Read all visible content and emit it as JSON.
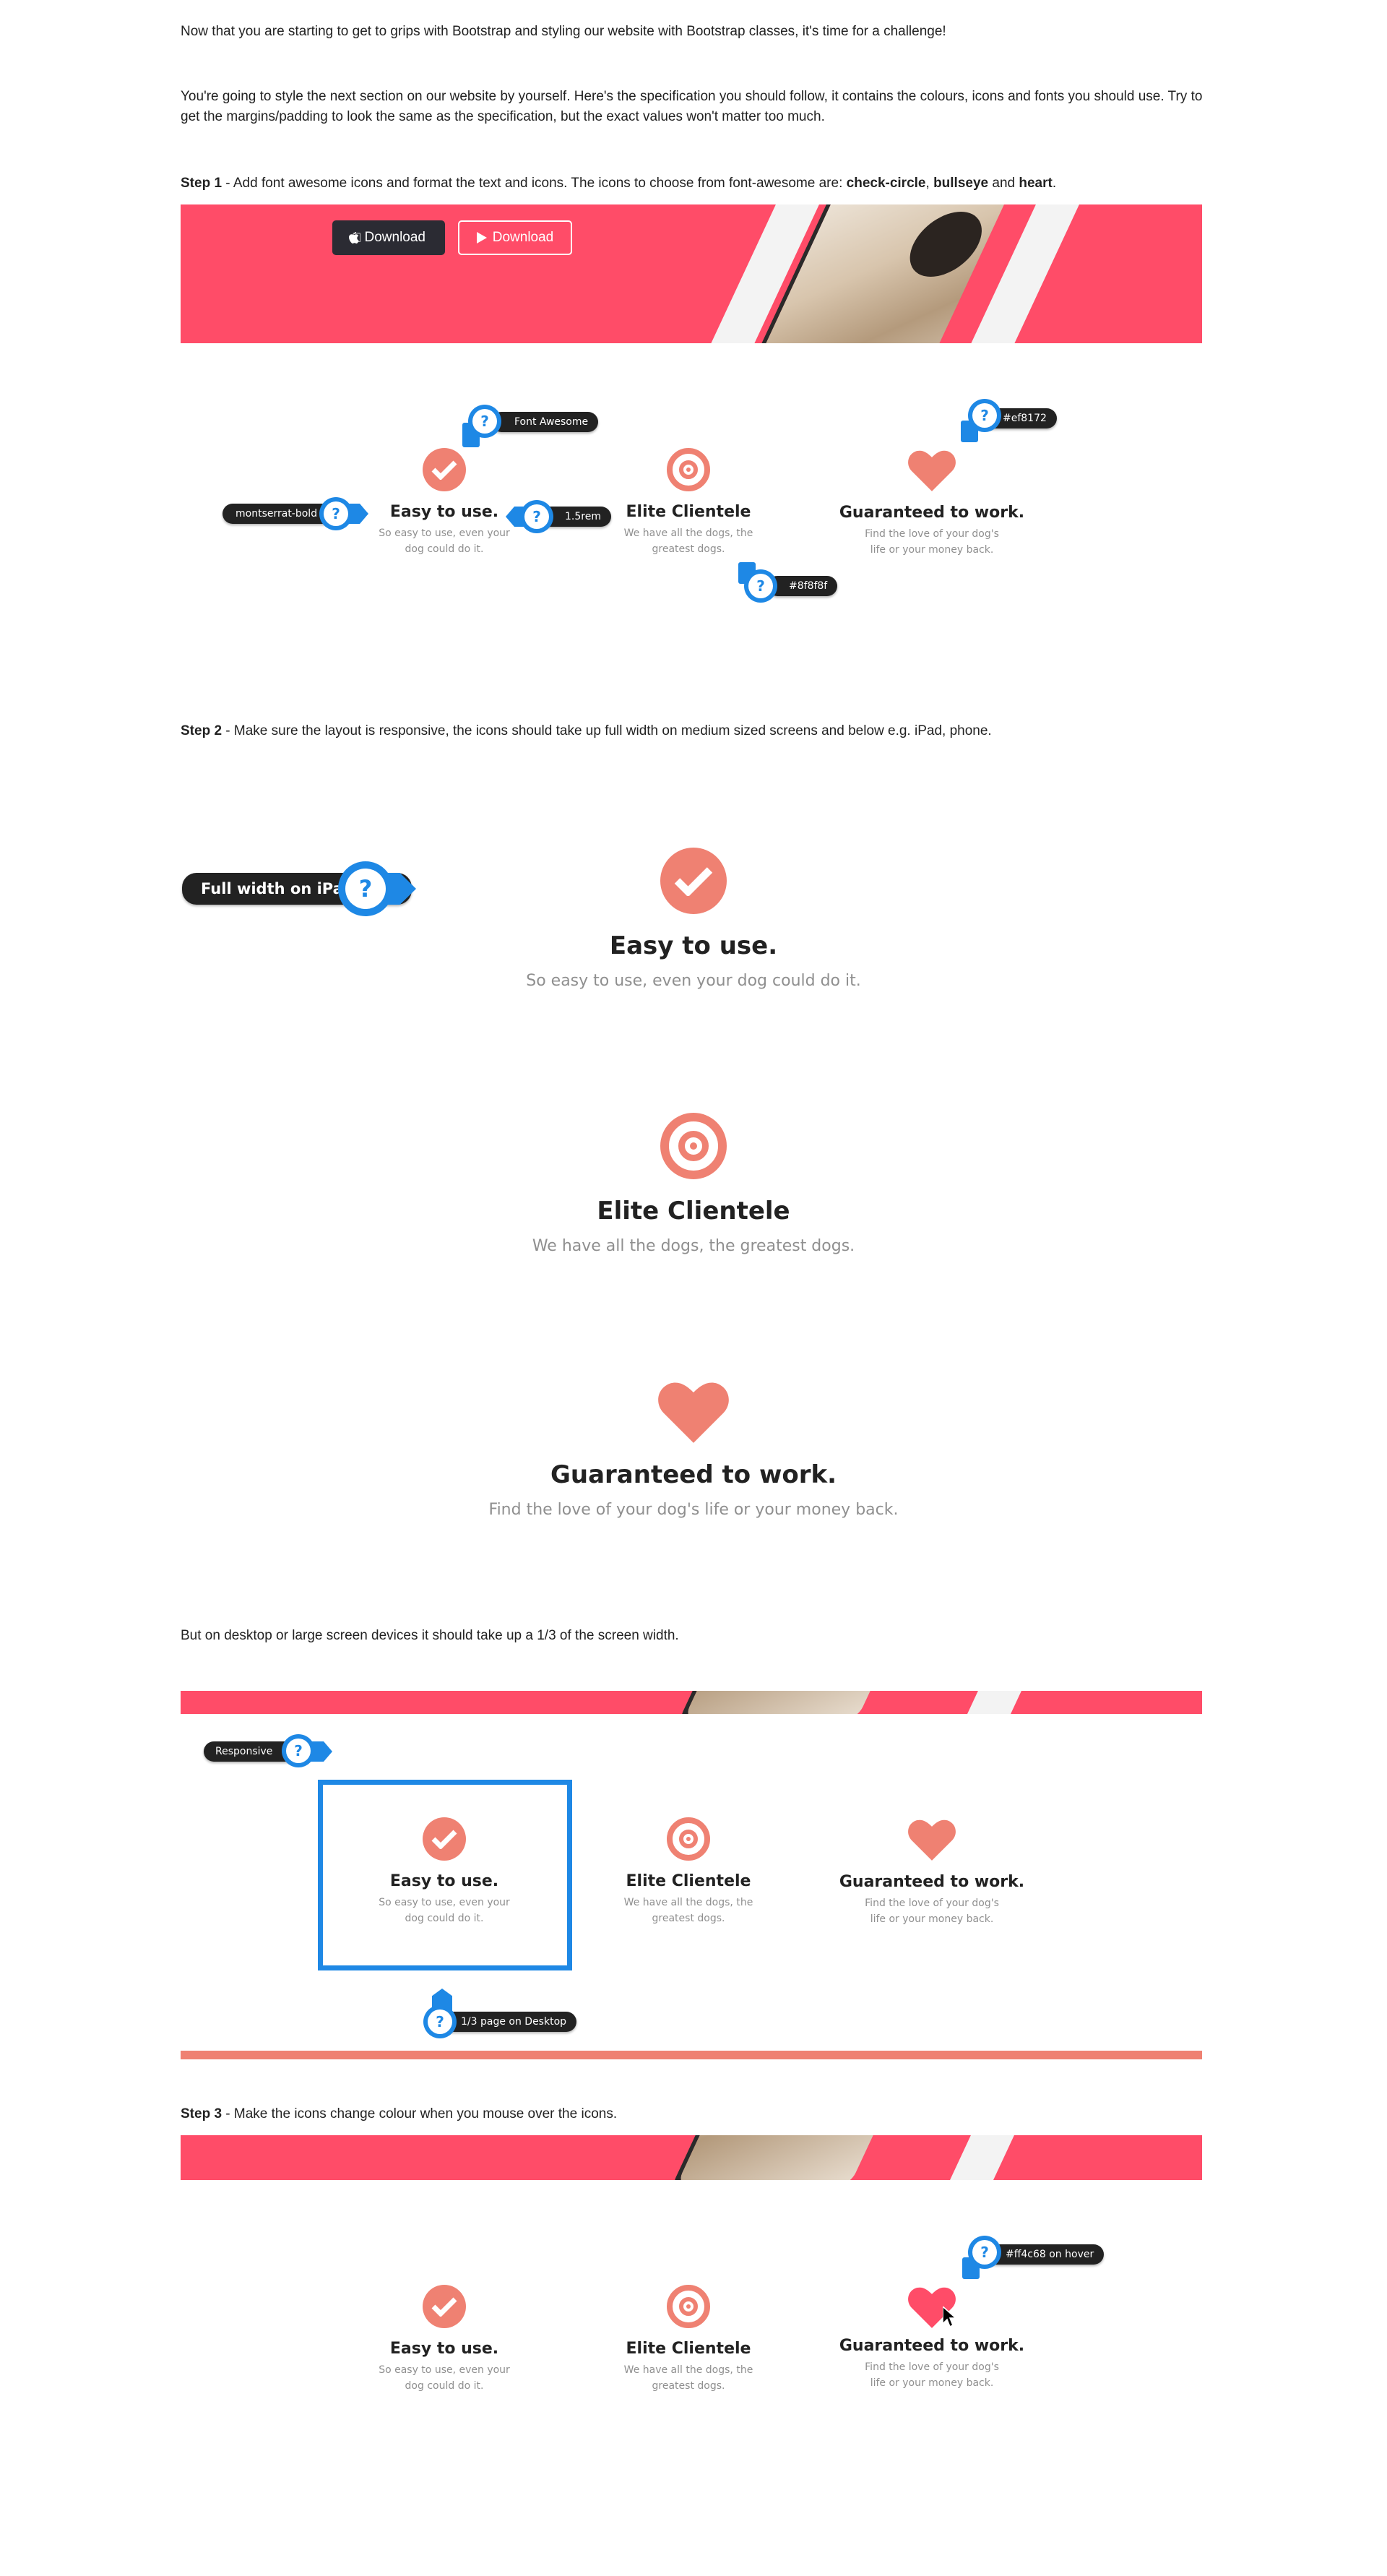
{
  "intro": "Now that you are starting to get to grips with Bootstrap and styling our website with Bootstrap classes, it's time for a challenge!",
  "spec_text": "You're going to style the next section on our website by yourself. Here's the specification you should follow, it contains the colours, icons and fonts you should use. Try to get the margins/padding to look the same as the specification, but the exact values won't matter too much.",
  "step1": {
    "label": "Step 1",
    "text_a": " - Add font awesome icons and format the text and icons. The icons to choose from font-awesome are: ",
    "icon1": "check-circle",
    "sep1": ", ",
    "icon2": "bullseye",
    "sep2": " and ",
    "icon3": "heart",
    "end": "."
  },
  "banner": {
    "download_dark": "Download",
    "download_outline": "Download",
    "color": "#ff4c68"
  },
  "features": [
    {
      "icon": "check-circle-icon",
      "title": "Easy to use.",
      "text": "So easy to use, even your dog could do it."
    },
    {
      "icon": "bullseye-icon",
      "title": "Elite Clientele",
      "text": "We have all the dogs, the greatest dogs."
    },
    {
      "icon": "heart-icon",
      "title": "Guaranteed to work.",
      "text": "Find the love of your dog's life or your money back."
    }
  ],
  "step1_annotations": {
    "font_awesome": "Font Awesome",
    "color1": "#ef8172",
    "font": "montserrat-bold",
    "size": "1.5rem",
    "color2": "#8f8f8f"
  },
  "step2": {
    "label": "Step 2",
    "text": " - Make sure the layout is responsive, the icons should take up full width on medium sized screens and below e.g. iPad, phone.",
    "annotation": "Full width on iPad"
  },
  "desktop_text": "But on desktop or large screen devices it should take up a 1/3 of the screen width.",
  "desktop_annotations": {
    "responsive": "Responsive",
    "third": "1/3 page on Desktop"
  },
  "step3": {
    "label": "Step 3",
    "text": " - Make the icons change colour when you mouse over the icons.",
    "annotation": "#ff4c68 on hover"
  },
  "qmark": "?",
  "colors": {
    "icon": "#ef8172",
    "hover": "#ff4c68",
    "text_grey": "#8f8f8f",
    "annotation_blue": "#1e88e5"
  }
}
